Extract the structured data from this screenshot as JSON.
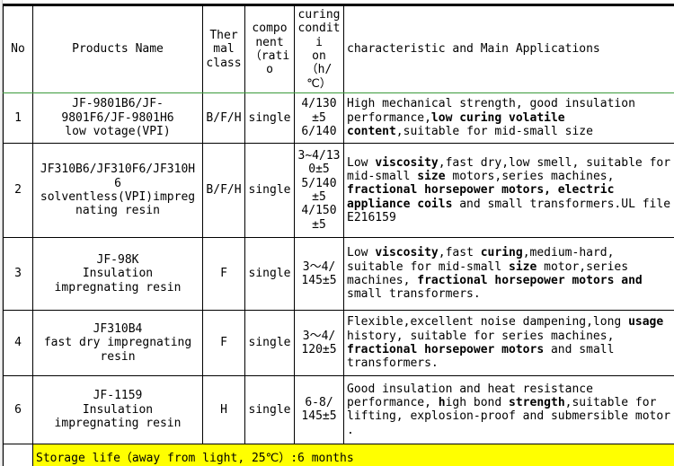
{
  "table": {
    "columns": [
      {
        "key": "no",
        "label": "No"
      },
      {
        "key": "name",
        "label": "Products Name"
      },
      {
        "key": "thermal",
        "label": "Ther\nmal\nclass"
      },
      {
        "key": "comp",
        "label": "compo\nnent\n（ratio"
      },
      {
        "key": "cure",
        "label": "curing\nconditi\non\n（h/℃）"
      },
      {
        "key": "desc",
        "label": "characteristic and Main Applications"
      }
    ],
    "header": {
      "no": "No",
      "name": "Products Name",
      "thermal_l1": "Ther",
      "thermal_l2": "mal",
      "thermal_l3": "class",
      "comp_l1": "compo",
      "comp_l2": "nent",
      "comp_l3": "（ratio",
      "cure_l1": "curing",
      "cure_l2": "conditi",
      "cure_l3": "on",
      "cure_l4": "（h/℃）",
      "desc": "characteristic and Main Applications"
    },
    "rows": [
      {
        "no": "1",
        "name_l1": "JF-9801B6/JF-",
        "name_l2": "9801F6/JF-9801H6",
        "name_l3": "low votage(VPI)",
        "thermal": "B/F/H",
        "comp": "single",
        "cure_l1": "4/130",
        "cure_l2": "±5",
        "cure_l3": "6/140",
        "desc_part1": "High mechanical strength, good insulation performance,",
        "desc_bold1": "low curing volatile content",
        "desc_part2": ",suitable for mid-small size"
      },
      {
        "no": "2",
        "name_l1": "JF310B6/JF310F6/JF310H",
        "name_l2": "6",
        "name_l3": "solventless(VPI)impreg",
        "name_l4": "nating resin",
        "thermal": "B/F/H",
        "comp": "single",
        "cure_l1": "3~4/13",
        "cure_l2": "0±5",
        "cure_l3": "5/140",
        "cure_l4": "±5",
        "cure_l5": "4/150",
        "cure_l6": "±5",
        "desc_a": "Low ",
        "desc_b1": "viscosity",
        "desc_b": ",fast dry,low smell, suitable for mid-small ",
        "desc_b2": "size",
        "desc_c": " motors,series machines, ",
        "desc_b3": "fractional horsepower motors, electric appliance coils",
        "desc_d": " and small transformers.UL file E216159"
      },
      {
        "no": "3",
        "name_l1": "JF-98K",
        "name_l2": "Insulation",
        "name_l3": "impregnating resin",
        "thermal": "F",
        "comp": "single",
        "cure_l1": "3～4/",
        "cure_l2": "145±5",
        "desc_a": "Low ",
        "desc_b1": "viscosity",
        "desc_b": ",fast ",
        "desc_b2": "curing",
        "desc_c": ",medium-hard, suitable for mid-small ",
        "desc_b3": "size",
        "desc_d": " motor,series machines, ",
        "desc_b4": "fractional horsepower motors and",
        "desc_e": " small transformers."
      },
      {
        "no": "4",
        "name_l1": "JF310B4",
        "name_l2": "fast dry impregnating",
        "name_l3": "resin",
        "thermal": "F",
        "comp": "single",
        "cure_l1": "3～4/",
        "cure_l2": "120±5",
        "desc_a": "Flexible,excellent noise dampening,long ",
        "desc_b1": "usage",
        "desc_b": " history, suitable for series machines, ",
        "desc_b2": "fractional horsepower motors",
        "desc_c": " and small transformers."
      },
      {
        "no": "6",
        "name_l1": "JF-1159",
        "name_l2": "Insulation",
        "name_l3": "impregnating resin",
        "thermal": "H",
        "comp": "single",
        "cure_l1": "6-8/",
        "cure_l2": "145±5",
        "desc_a": "Good insulation and heat resistance performance, ",
        "desc_b1": "h",
        "desc_b": "igh bond ",
        "desc_b2": "strength",
        "desc_c": ",suitable for lifting, explosion-proof and submersible motor ."
      }
    ],
    "footer": {
      "no": "",
      "note": "Storage life（away from light, 25℃）:6 months"
    }
  },
  "colors": {
    "highlight": "#ffff00",
    "grid_line": "#000000",
    "header_underline": "#3b9b3b",
    "page_background": "#ffffff"
  }
}
